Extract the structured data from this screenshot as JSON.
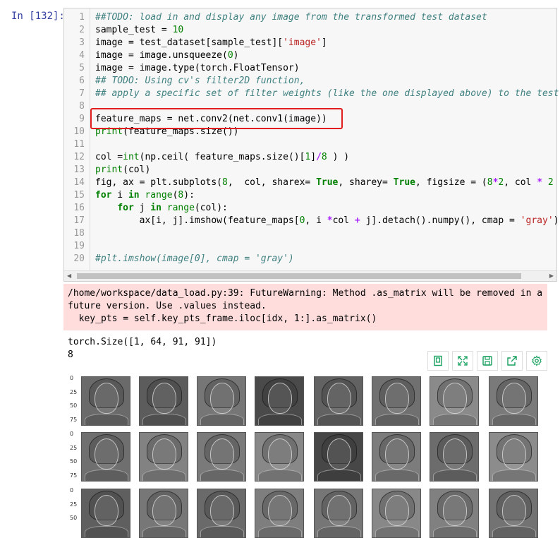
{
  "cell": {
    "prompt": "In [132]:",
    "lines": [
      {
        "n": "1",
        "tokens": [
          {
            "t": "##TODO: load in and display any image from the transformed test dataset",
            "c": "cm"
          }
        ]
      },
      {
        "n": "2",
        "tokens": [
          {
            "t": "sample_test = ",
            "c": ""
          },
          {
            "t": "10",
            "c": "num"
          }
        ]
      },
      {
        "n": "3",
        "tokens": [
          {
            "t": "image = test_dataset[sample_test][",
            "c": ""
          },
          {
            "t": "'image'",
            "c": "str"
          },
          {
            "t": "]",
            "c": ""
          }
        ]
      },
      {
        "n": "4",
        "tokens": [
          {
            "t": "image = image.unsqueeze(",
            "c": ""
          },
          {
            "t": "0",
            "c": "num"
          },
          {
            "t": ")",
            "c": ""
          }
        ]
      },
      {
        "n": "5",
        "tokens": [
          {
            "t": "image = image.type(torch.FloatTensor)",
            "c": ""
          }
        ]
      },
      {
        "n": "6",
        "tokens": [
          {
            "t": "## TODO: Using cv's filter2D function,",
            "c": "cm"
          }
        ]
      },
      {
        "n": "7",
        "tokens": [
          {
            "t": "## apply a specific set of filter weights (like the one displayed above) to the test",
            "c": "cm"
          }
        ]
      },
      {
        "n": "8",
        "tokens": []
      },
      {
        "n": "9",
        "tokens": [
          {
            "t": "feature_maps = net.conv2(net.conv1(image))",
            "c": ""
          }
        ]
      },
      {
        "n": "10",
        "tokens": [
          {
            "t": "print",
            "c": "bi"
          },
          {
            "t": "(feature_maps.size())",
            "c": ""
          }
        ]
      },
      {
        "n": "11",
        "tokens": []
      },
      {
        "n": "12",
        "tokens": [
          {
            "t": "col =",
            "c": ""
          },
          {
            "t": "int",
            "c": "bi"
          },
          {
            "t": "(np.ceil( feature_maps.size()[",
            "c": ""
          },
          {
            "t": "1",
            "c": "num"
          },
          {
            "t": "]",
            "c": ""
          },
          {
            "t": "/",
            "c": "op"
          },
          {
            "t": "8",
            "c": "num"
          },
          {
            "t": " ) )",
            "c": ""
          }
        ]
      },
      {
        "n": "13",
        "tokens": [
          {
            "t": "print",
            "c": "bi"
          },
          {
            "t": "(col)",
            "c": ""
          }
        ]
      },
      {
        "n": "14",
        "tokens": [
          {
            "t": "fig, ax = plt.subplots(",
            "c": ""
          },
          {
            "t": "8",
            "c": "num"
          },
          {
            "t": ",  col, sharex= ",
            "c": ""
          },
          {
            "t": "True",
            "c": "kw"
          },
          {
            "t": ", sharey= ",
            "c": ""
          },
          {
            "t": "True",
            "c": "kw"
          },
          {
            "t": ", figsize = (",
            "c": ""
          },
          {
            "t": "8",
            "c": "num"
          },
          {
            "t": "*",
            "c": "op"
          },
          {
            "t": "2",
            "c": "num"
          },
          {
            "t": ", col ",
            "c": ""
          },
          {
            "t": "*",
            "c": "op"
          },
          {
            "t": " ",
            "c": ""
          },
          {
            "t": "2",
            "c": "num"
          },
          {
            "t": " ))",
            "c": ""
          }
        ]
      },
      {
        "n": "15",
        "tokens": [
          {
            "t": "for",
            "c": "kw"
          },
          {
            "t": " i ",
            "c": ""
          },
          {
            "t": "in",
            "c": "kw"
          },
          {
            "t": " ",
            "c": ""
          },
          {
            "t": "range",
            "c": "bi"
          },
          {
            "t": "(",
            "c": ""
          },
          {
            "t": "8",
            "c": "num"
          },
          {
            "t": "):",
            "c": ""
          }
        ]
      },
      {
        "n": "16",
        "tokens": [
          {
            "t": "    ",
            "c": ""
          },
          {
            "t": "for",
            "c": "kw"
          },
          {
            "t": " j ",
            "c": ""
          },
          {
            "t": "in",
            "c": "kw"
          },
          {
            "t": " ",
            "c": ""
          },
          {
            "t": "range",
            "c": "bi"
          },
          {
            "t": "(col):",
            "c": ""
          }
        ]
      },
      {
        "n": "17",
        "tokens": [
          {
            "t": "        ax[i, j].imshow(feature_maps[",
            "c": ""
          },
          {
            "t": "0",
            "c": "num"
          },
          {
            "t": ", i ",
            "c": ""
          },
          {
            "t": "*",
            "c": "op"
          },
          {
            "t": "col ",
            "c": ""
          },
          {
            "t": "+",
            "c": "op"
          },
          {
            "t": " j].detach().numpy(), cmap = ",
            "c": ""
          },
          {
            "t": "'gray'",
            "c": "str"
          },
          {
            "t": ")",
            "c": ""
          }
        ]
      },
      {
        "n": "18",
        "tokens": []
      },
      {
        "n": "19",
        "tokens": []
      },
      {
        "n": "20",
        "tokens": [
          {
            "t": "#plt.imshow(image[0], cmap = 'gray')",
            "c": "cm"
          }
        ]
      }
    ]
  },
  "stderr": "/home/workspace/data_load.py:39: FutureWarning: Method .as_matrix will be removed in a\nfuture version. Use .values instead.\n  key_pts = self.key_pts_frame.iloc[idx, 1:].as_matrix()",
  "stdout": "torch.Size([1, 64, 91, 91])\n8",
  "toolbar": [
    {
      "name": "save-as-image-icon"
    },
    {
      "name": "fullscreen-icon"
    },
    {
      "name": "save-icon"
    },
    {
      "name": "share-icon"
    },
    {
      "name": "settings-icon"
    }
  ],
  "accent_color": "#16a05d",
  "figure": {
    "y_ticks": [
      "0",
      "25",
      "50",
      "75"
    ],
    "rows_visible": 3,
    "cols": 8,
    "shades": [
      [
        "#6a6a6a",
        "#5c5c5c",
        "#767676",
        "#4a4a4a",
        "#626262",
        "#707070",
        "#8a8a8a",
        "#7a7a7a"
      ],
      [
        "#6f6f6f",
        "#828282",
        "#7a7a7a",
        "#888888",
        "#474747",
        "#7c7c7c",
        "#6c6c6c",
        "#8c8c8c"
      ],
      [
        "#5f5f5f",
        "#777777",
        "#6a6a6a",
        "#7e7e7e",
        "#767676",
        "#888888",
        "#808080",
        "#737373"
      ]
    ]
  }
}
